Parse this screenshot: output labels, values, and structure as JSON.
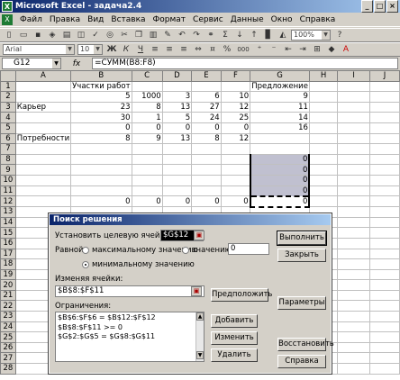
{
  "window": {
    "title": "Microsoft Excel - задача2.4"
  },
  "menu": [
    "Файл",
    "Правка",
    "Вид",
    "Вставка",
    "Формат",
    "Сервис",
    "Данные",
    "Окно",
    "Справка"
  ],
  "toolbar": {
    "zoom": "100%",
    "font_name": "Arial",
    "font_size": "10",
    "bold": "Ж",
    "italic": "К",
    "underline": "Ч",
    "percent": "%",
    "thousands": "000"
  },
  "formula_bar": {
    "cell_ref": "G12",
    "fx": "fx",
    "formula": "=СУММ(B8:F8)"
  },
  "columns": [
    "A",
    "B",
    "C",
    "D",
    "E",
    "F",
    "G",
    "H",
    "I",
    "J"
  ],
  "rows": [
    {
      "n": "1",
      "c": [
        "",
        "Участки работ",
        "",
        "",
        "",
        "",
        "Предложение",
        "",
        "",
        ""
      ]
    },
    {
      "n": "2",
      "c": [
        "",
        "5",
        "1000",
        "3",
        "6",
        "10",
        "9",
        "",
        "",
        ""
      ]
    },
    {
      "n": "3",
      "c": [
        "Карьер",
        "23",
        "8",
        "13",
        "27",
        "12",
        "11",
        "",
        "",
        ""
      ]
    },
    {
      "n": "4",
      "c": [
        "",
        "30",
        "1",
        "5",
        "24",
        "25",
        "14",
        "",
        "",
        ""
      ]
    },
    {
      "n": "5",
      "c": [
        "",
        "0",
        "0",
        "0",
        "0",
        "0",
        "16",
        "",
        "",
        ""
      ]
    },
    {
      "n": "6",
      "c": [
        "Потребности",
        "8",
        "9",
        "13",
        "8",
        "12",
        "",
        "",
        "",
        ""
      ]
    },
    {
      "n": "7",
      "c": [
        "",
        "",
        "",
        "",
        "",
        "",
        "",
        "",
        "",
        ""
      ]
    },
    {
      "n": "8",
      "c": [
        "",
        "",
        "",
        "",
        "",
        "",
        "0",
        "",
        "",
        ""
      ]
    },
    {
      "n": "9",
      "c": [
        "",
        "",
        "",
        "",
        "",
        "",
        "0",
        "",
        "",
        ""
      ]
    },
    {
      "n": "10",
      "c": [
        "",
        "",
        "",
        "",
        "",
        "",
        "0",
        "",
        "",
        ""
      ]
    },
    {
      "n": "11",
      "c": [
        "",
        "",
        "",
        "",
        "",
        "",
        "0",
        "",
        "",
        ""
      ]
    },
    {
      "n": "12",
      "c": [
        "",
        "0",
        "0",
        "0",
        "0",
        "0",
        "0",
        "",
        "",
        ""
      ]
    },
    {
      "n": "13",
      "c": [
        "",
        "",
        "",
        "",
        "",
        "",
        "",
        "",
        "",
        ""
      ]
    },
    {
      "n": "14",
      "c": [
        "",
        "",
        "",
        "",
        "",
        "",
        "",
        "",
        "",
        ""
      ]
    },
    {
      "n": "15",
      "c": [
        "",
        "",
        "",
        "",
        "",
        "",
        "",
        "",
        "",
        ""
      ]
    },
    {
      "n": "16",
      "c": [
        "",
        "",
        "",
        "",
        "",
        "",
        "",
        "",
        "",
        ""
      ]
    },
    {
      "n": "17",
      "c": [
        "",
        "",
        "",
        "",
        "",
        "",
        "",
        "",
        "",
        ""
      ]
    },
    {
      "n": "18",
      "c": [
        "",
        "",
        "",
        "",
        "",
        "",
        "",
        "",
        "",
        ""
      ]
    },
    {
      "n": "19",
      "c": [
        "",
        "",
        "",
        "",
        "",
        "",
        "",
        "",
        "",
        ""
      ]
    },
    {
      "n": "20",
      "c": [
        "",
        "",
        "",
        "",
        "",
        "",
        "",
        "",
        "",
        ""
      ]
    },
    {
      "n": "21",
      "c": [
        "",
        "",
        "",
        "",
        "",
        "",
        "",
        "",
        "",
        ""
      ]
    },
    {
      "n": "22",
      "c": [
        "",
        "",
        "",
        "",
        "",
        "",
        "",
        "",
        "",
        ""
      ]
    },
    {
      "n": "23",
      "c": [
        "",
        "",
        "",
        "",
        "",
        "",
        "",
        "",
        "",
        ""
      ]
    },
    {
      "n": "24",
      "c": [
        "",
        "",
        "",
        "",
        "",
        "",
        "",
        "",
        "",
        ""
      ]
    },
    {
      "n": "25",
      "c": [
        "",
        "",
        "",
        "",
        "",
        "",
        "",
        "",
        "",
        ""
      ]
    },
    {
      "n": "26",
      "c": [
        "",
        "",
        "",
        "",
        "",
        "",
        "",
        "",
        "",
        ""
      ]
    },
    {
      "n": "27",
      "c": [
        "",
        "",
        "",
        "",
        "",
        "",
        "",
        "",
        "",
        ""
      ]
    },
    {
      "n": "28",
      "c": [
        "",
        "",
        "",
        "",
        "",
        "",
        "",
        "",
        "",
        ""
      ]
    }
  ],
  "dialog": {
    "title": "Поиск решения",
    "target_label": "Установить целевую ячейку:",
    "target_value": "$G$12",
    "equal_label": "Равной:",
    "radio_max": "максимальному значению",
    "radio_value": "значению:",
    "value_field": "0",
    "radio_min": "минимальному значению",
    "changing_label": "Изменяя ячейки:",
    "changing_value": "$B$8:$F$11",
    "constraints_label": "Ограничения:",
    "constraints": [
      "$B$6:$F$6 = $B$12:$F$12",
      "$B$8:$F$11 >= 0",
      "$G$2:$G$5 = $G$8:$G$11"
    ],
    "btn_solve": "Выполнить",
    "btn_close": "Закрыть",
    "btn_guess": "Предположить",
    "btn_options": "Параметры",
    "btn_add": "Добавить",
    "btn_change": "Изменить",
    "btn_delete": "Удалить",
    "btn_reset": "Восстановить",
    "btn_help": "Справка",
    "selected_radio": "min"
  }
}
